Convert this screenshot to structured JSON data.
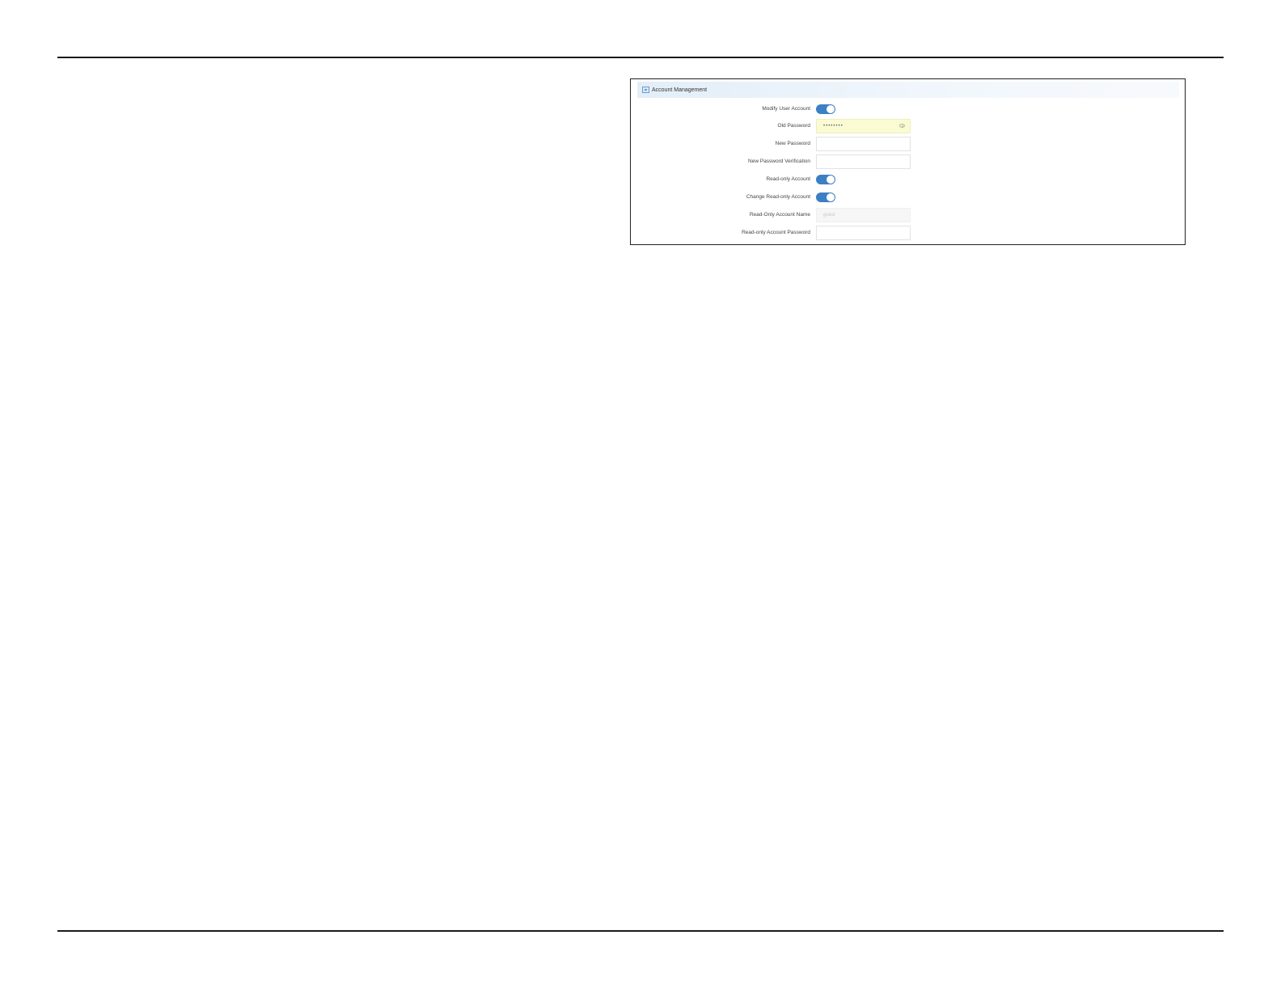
{
  "panel": {
    "title": "Account Management",
    "header_icon": "panel-icon"
  },
  "form": {
    "modify_user_account": {
      "label": "Modify User Account",
      "enabled": true
    },
    "old_password": {
      "label": "Old Password",
      "value": "••••••••",
      "icon": "eye-icon"
    },
    "new_password": {
      "label": "New Password",
      "value": ""
    },
    "new_password_verification": {
      "label": "New Password Verification",
      "value": ""
    },
    "read_only_account": {
      "label": "Read-only Account",
      "enabled": true
    },
    "change_read_only_account": {
      "label": "Change Read-only Account",
      "enabled": true
    },
    "read_only_account_name": {
      "label": "Read-Only Account Name",
      "value": "guest"
    },
    "read_only_account_password": {
      "label": "Read-only Account Password",
      "value": ""
    }
  },
  "colors": {
    "toggle_on": "#3d7fc4",
    "autofill_bg": "#fafbd2",
    "header_bg": "#e3eef8"
  }
}
